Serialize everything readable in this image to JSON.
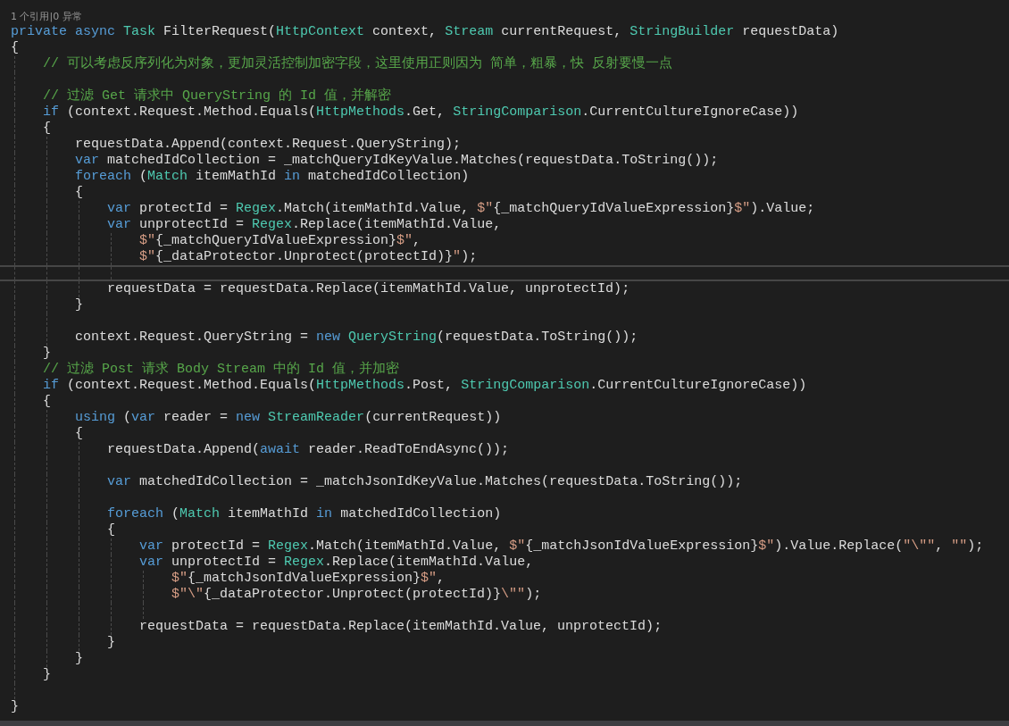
{
  "codelens": "1 个引用|0 异常",
  "lines": [
    {
      "kind": "code",
      "current": false,
      "tokens": [
        {
          "kind": "keyword",
          "text": "private async "
        },
        {
          "kind": "type",
          "text": "Task"
        },
        {
          "kind": "plain",
          "text": " FilterRequest("
        },
        {
          "kind": "type",
          "text": "HttpContext"
        },
        {
          "kind": "plain",
          "text": " context, "
        },
        {
          "kind": "type",
          "text": "Stream"
        },
        {
          "kind": "plain",
          "text": " currentRequest, "
        },
        {
          "kind": "type",
          "text": "StringBuilder"
        },
        {
          "kind": "plain",
          "text": " requestData)"
        }
      ]
    },
    {
      "kind": "code",
      "current": false,
      "tokens": [
        {
          "kind": "plain",
          "text": "{"
        }
      ]
    },
    {
      "kind": "code",
      "current": false,
      "tokens": [
        {
          "kind": "comment",
          "text": "    // 可以考虑反序列化为对象，更加灵活控制加密字段，这里使用正则因为 简单，粗暴，快 反射要慢一点"
        }
      ]
    },
    {
      "kind": "blank",
      "current": false
    },
    {
      "kind": "code",
      "current": false,
      "tokens": [
        {
          "kind": "comment",
          "text": "    // 过滤 Get 请求中 QueryString 的 Id 值，并解密"
        }
      ]
    },
    {
      "kind": "code",
      "current": false,
      "tokens": [
        {
          "kind": "keyword",
          "text": "    if"
        },
        {
          "kind": "plain",
          "text": " (context.Request.Method.Equals("
        },
        {
          "kind": "type",
          "text": "HttpMethods"
        },
        {
          "kind": "plain",
          "text": ".Get, "
        },
        {
          "kind": "type",
          "text": "StringComparison"
        },
        {
          "kind": "plain",
          "text": ".CurrentCultureIgnoreCase))"
        }
      ]
    },
    {
      "kind": "code",
      "current": false,
      "tokens": [
        {
          "kind": "plain",
          "text": "    {"
        }
      ]
    },
    {
      "kind": "code",
      "current": false,
      "tokens": [
        {
          "kind": "plain",
          "text": "        requestData.Append(context.Request.QueryString);"
        }
      ]
    },
    {
      "kind": "code",
      "current": false,
      "tokens": [
        {
          "kind": "keyword",
          "text": "        var"
        },
        {
          "kind": "plain",
          "text": " matchedIdCollection = _matchQueryIdKeyValue.Matches(requestData.ToString());"
        }
      ]
    },
    {
      "kind": "code",
      "current": false,
      "tokens": [
        {
          "kind": "keyword",
          "text": "        foreach"
        },
        {
          "kind": "plain",
          "text": " ("
        },
        {
          "kind": "type",
          "text": "Match"
        },
        {
          "kind": "plain",
          "text": " itemMathId "
        },
        {
          "kind": "keyword",
          "text": "in"
        },
        {
          "kind": "plain",
          "text": " matchedIdCollection)"
        }
      ]
    },
    {
      "kind": "code",
      "current": false,
      "tokens": [
        {
          "kind": "plain",
          "text": "        {"
        }
      ]
    },
    {
      "kind": "code",
      "current": false,
      "tokens": [
        {
          "kind": "keyword",
          "text": "            var"
        },
        {
          "kind": "plain",
          "text": " protectId = "
        },
        {
          "kind": "type",
          "text": "Regex"
        },
        {
          "kind": "plain",
          "text": ".Match(itemMathId.Value, "
        },
        {
          "kind": "string",
          "text": "$\""
        },
        {
          "kind": "plain",
          "text": "{_matchQueryIdValueExpression}"
        },
        {
          "kind": "string",
          "text": "$\""
        },
        {
          "kind": "plain",
          "text": ").Value;"
        }
      ]
    },
    {
      "kind": "code",
      "current": false,
      "tokens": [
        {
          "kind": "keyword",
          "text": "            var"
        },
        {
          "kind": "plain",
          "text": " unprotectId = "
        },
        {
          "kind": "type",
          "text": "Regex"
        },
        {
          "kind": "plain",
          "text": ".Replace(itemMathId.Value,"
        }
      ]
    },
    {
      "kind": "code",
      "current": false,
      "tokens": [
        {
          "kind": "string",
          "text": "                $\""
        },
        {
          "kind": "plain",
          "text": "{_matchQueryIdValueExpression}"
        },
        {
          "kind": "string",
          "text": "$\""
        },
        {
          "kind": "plain",
          "text": ","
        }
      ]
    },
    {
      "kind": "code",
      "current": false,
      "tokens": [
        {
          "kind": "string",
          "text": "                $\""
        },
        {
          "kind": "plain",
          "text": "{_dataProtector.Unprotect(protectId)}"
        },
        {
          "kind": "string",
          "text": "\""
        },
        {
          "kind": "plain",
          "text": ");"
        }
      ]
    },
    {
      "kind": "blank",
      "current": true
    },
    {
      "kind": "code",
      "current": false,
      "tokens": [
        {
          "kind": "plain",
          "text": "            requestData = requestData.Replace(itemMathId.Value, unprotectId);"
        }
      ]
    },
    {
      "kind": "code",
      "current": false,
      "tokens": [
        {
          "kind": "plain",
          "text": "        }"
        }
      ]
    },
    {
      "kind": "blank",
      "current": false
    },
    {
      "kind": "code",
      "current": false,
      "tokens": [
        {
          "kind": "plain",
          "text": "        context.Request.QueryString = "
        },
        {
          "kind": "keyword",
          "text": "new "
        },
        {
          "kind": "type",
          "text": "QueryString"
        },
        {
          "kind": "plain",
          "text": "(requestData.ToString());"
        }
      ]
    },
    {
      "kind": "code",
      "current": false,
      "tokens": [
        {
          "kind": "plain",
          "text": "    }"
        }
      ]
    },
    {
      "kind": "code",
      "current": false,
      "tokens": [
        {
          "kind": "comment",
          "text": "    // 过滤 Post 请求 Body Stream 中的 Id 值，并加密"
        }
      ]
    },
    {
      "kind": "code",
      "current": false,
      "tokens": [
        {
          "kind": "keyword",
          "text": "    if"
        },
        {
          "kind": "plain",
          "text": " (context.Request.Method.Equals("
        },
        {
          "kind": "type",
          "text": "HttpMethods"
        },
        {
          "kind": "plain",
          "text": ".Post, "
        },
        {
          "kind": "type",
          "text": "StringComparison"
        },
        {
          "kind": "plain",
          "text": ".CurrentCultureIgnoreCase))"
        }
      ]
    },
    {
      "kind": "code",
      "current": false,
      "tokens": [
        {
          "kind": "plain",
          "text": "    {"
        }
      ]
    },
    {
      "kind": "code",
      "current": false,
      "tokens": [
        {
          "kind": "keyword",
          "text": "        using"
        },
        {
          "kind": "plain",
          "text": " ("
        },
        {
          "kind": "keyword",
          "text": "var"
        },
        {
          "kind": "plain",
          "text": " reader = "
        },
        {
          "kind": "keyword",
          "text": "new "
        },
        {
          "kind": "type",
          "text": "StreamReader"
        },
        {
          "kind": "plain",
          "text": "(currentRequest))"
        }
      ]
    },
    {
      "kind": "code",
      "current": false,
      "tokens": [
        {
          "kind": "plain",
          "text": "        {"
        }
      ]
    },
    {
      "kind": "code",
      "current": false,
      "tokens": [
        {
          "kind": "plain",
          "text": "            requestData.Append("
        },
        {
          "kind": "keyword",
          "text": "await"
        },
        {
          "kind": "plain",
          "text": " reader.ReadToEndAsync());"
        }
      ]
    },
    {
      "kind": "blank",
      "current": false
    },
    {
      "kind": "code",
      "current": false,
      "tokens": [
        {
          "kind": "keyword",
          "text": "            var"
        },
        {
          "kind": "plain",
          "text": " matchedIdCollection = _matchJsonIdKeyValue.Matches(requestData.ToString());"
        }
      ]
    },
    {
      "kind": "blank",
      "current": false
    },
    {
      "kind": "code",
      "current": false,
      "tokens": [
        {
          "kind": "keyword",
          "text": "            foreach"
        },
        {
          "kind": "plain",
          "text": " ("
        },
        {
          "kind": "type",
          "text": "Match"
        },
        {
          "kind": "plain",
          "text": " itemMathId "
        },
        {
          "kind": "keyword",
          "text": "in"
        },
        {
          "kind": "plain",
          "text": " matchedIdCollection)"
        }
      ]
    },
    {
      "kind": "code",
      "current": false,
      "tokens": [
        {
          "kind": "plain",
          "text": "            {"
        }
      ]
    },
    {
      "kind": "code",
      "current": false,
      "tokens": [
        {
          "kind": "keyword",
          "text": "                var"
        },
        {
          "kind": "plain",
          "text": " protectId = "
        },
        {
          "kind": "type",
          "text": "Regex"
        },
        {
          "kind": "plain",
          "text": ".Match(itemMathId.Value, "
        },
        {
          "kind": "string",
          "text": "$\""
        },
        {
          "kind": "plain",
          "text": "{_matchJsonIdValueExpression}"
        },
        {
          "kind": "string",
          "text": "$\""
        },
        {
          "kind": "plain",
          "text": ").Value.Replace("
        },
        {
          "kind": "string",
          "text": "\"\\\"\""
        },
        {
          "kind": "plain",
          "text": ", "
        },
        {
          "kind": "string",
          "text": "\"\""
        },
        {
          "kind": "plain",
          "text": ");"
        }
      ]
    },
    {
      "kind": "code",
      "current": false,
      "tokens": [
        {
          "kind": "keyword",
          "text": "                var"
        },
        {
          "kind": "plain",
          "text": " unprotectId = "
        },
        {
          "kind": "type",
          "text": "Regex"
        },
        {
          "kind": "plain",
          "text": ".Replace(itemMathId.Value,"
        }
      ]
    },
    {
      "kind": "code",
      "current": false,
      "tokens": [
        {
          "kind": "string",
          "text": "                    $\""
        },
        {
          "kind": "plain",
          "text": "{_matchJsonIdValueExpression}"
        },
        {
          "kind": "string",
          "text": "$\""
        },
        {
          "kind": "plain",
          "text": ","
        }
      ]
    },
    {
      "kind": "code",
      "current": false,
      "tokens": [
        {
          "kind": "string",
          "text": "                    $\"\\\""
        },
        {
          "kind": "plain",
          "text": "{_dataProtector.Unprotect(protectId)}"
        },
        {
          "kind": "string",
          "text": "\\\"\""
        },
        {
          "kind": "plain",
          "text": ");"
        }
      ]
    },
    {
      "kind": "blank",
      "current": false
    },
    {
      "kind": "code",
      "current": false,
      "tokens": [
        {
          "kind": "plain",
          "text": "                requestData = requestData.Replace(itemMathId.Value, unprotectId);"
        }
      ]
    },
    {
      "kind": "code",
      "current": false,
      "tokens": [
        {
          "kind": "plain",
          "text": "            }"
        }
      ]
    },
    {
      "kind": "code",
      "current": false,
      "tokens": [
        {
          "kind": "plain",
          "text": "        }"
        }
      ]
    },
    {
      "kind": "code",
      "current": false,
      "tokens": [
        {
          "kind": "plain",
          "text": "    }"
        }
      ]
    },
    {
      "kind": "blank",
      "current": false
    },
    {
      "kind": "code",
      "current": false,
      "tokens": [
        {
          "kind": "plain",
          "text": "}"
        }
      ]
    }
  ]
}
